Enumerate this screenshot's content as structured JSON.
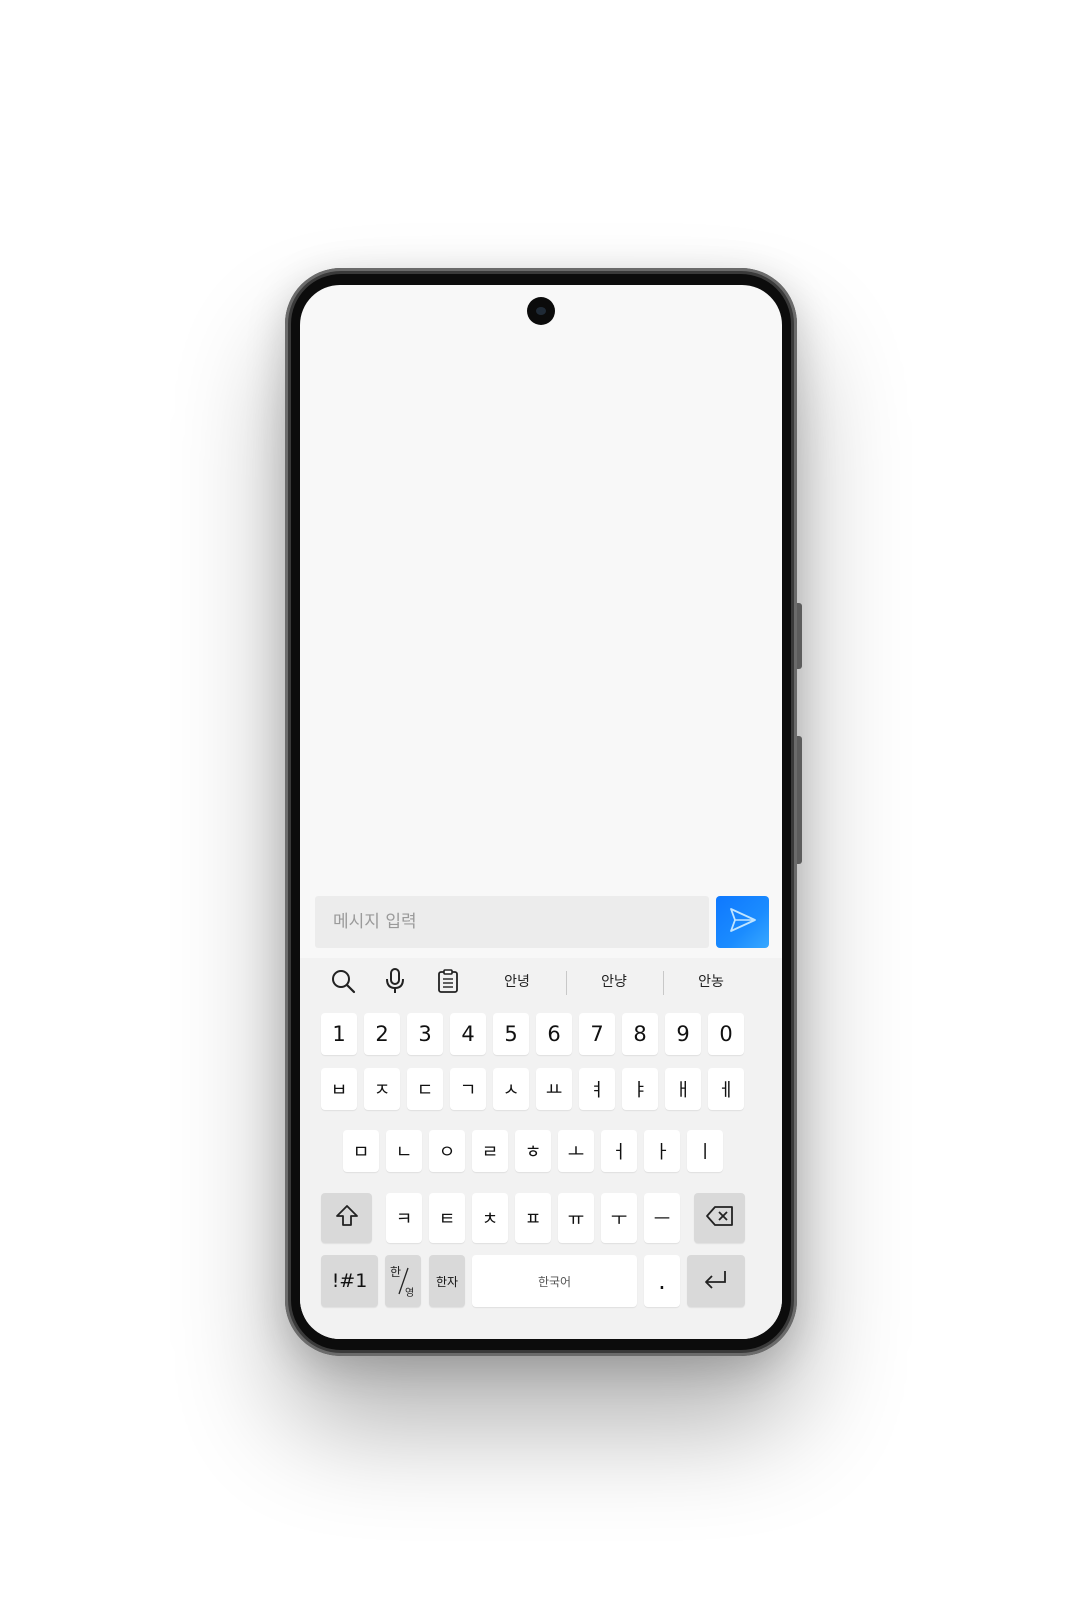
{
  "composer": {
    "placeholder": "메시지 입력"
  },
  "colors": {
    "send_button": "#1181ff",
    "keyboard_bg": "#f2f2f2",
    "function_key_bg": "#d9d9d9"
  },
  "toolbar": {
    "icons": [
      "search-icon",
      "microphone-icon",
      "clipboard-icon"
    ],
    "suggestions": [
      "안녕",
      "안냥",
      "안농"
    ]
  },
  "keyboard": {
    "number_row": [
      "1",
      "2",
      "3",
      "4",
      "5",
      "6",
      "7",
      "8",
      "9",
      "0"
    ],
    "row1": [
      "ㅂ",
      "ㅈ",
      "ㄷ",
      "ㄱ",
      "ㅅ",
      "ㅛ",
      "ㅕ",
      "ㅑ",
      "ㅐ",
      "ㅔ"
    ],
    "row2": [
      "ㅁ",
      "ㄴ",
      "ㅇ",
      "ㄹ",
      "ㅎ",
      "ㅗ",
      "ㅓ",
      "ㅏ",
      "ㅣ"
    ],
    "row3": [
      "ㅋ",
      "ㅌ",
      "ㅊ",
      "ㅍ",
      "ㅠ",
      "ㅜ",
      "ㅡ"
    ],
    "symbols_key": "!#1",
    "lang_toggle_top": "한",
    "lang_toggle_bottom": "영",
    "hanja_key": "한자",
    "space_label": "한국어",
    "period_key": "."
  }
}
